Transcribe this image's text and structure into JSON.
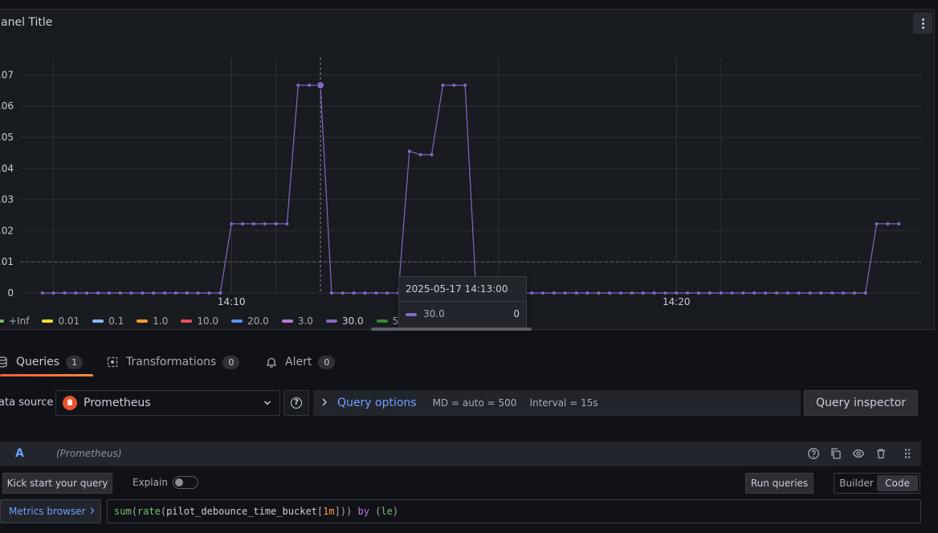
{
  "panel": {
    "title": "anel Title",
    "menu_icon": "kebab-menu-icon"
  },
  "chart_data": {
    "type": "line",
    "y_ticks": [
      "0",
      ".01",
      ".02",
      ".03",
      ".04",
      ".05",
      ".06",
      ".07"
    ],
    "ylim": [
      0,
      0.0755
    ],
    "x_tick_labels": [
      {
        "time": "14:10",
        "label": "14:10"
      },
      {
        "time": "14:20",
        "label": "14:20"
      }
    ],
    "xlim": [
      "14:05:15",
      "14:25:30"
    ],
    "threshold": 0.01,
    "grid": true,
    "series": [
      {
        "name": "30.0",
        "color": "#8268c4",
        "x": [
          "14:05:45",
          "14:06:00",
          "14:06:15",
          "14:06:30",
          "14:06:45",
          "14:07:00",
          "14:07:15",
          "14:07:30",
          "14:07:45",
          "14:08:00",
          "14:08:15",
          "14:08:30",
          "14:08:45",
          "14:09:00",
          "14:09:15",
          "14:09:30",
          "14:09:45",
          "14:10:00",
          "14:10:15",
          "14:10:30",
          "14:10:45",
          "14:11:00",
          "14:11:15",
          "14:11:30",
          "14:11:45",
          "14:12:00",
          "14:12:15",
          "14:12:30",
          "14:12:45",
          "14:13:00",
          "14:13:15",
          "14:13:30",
          "14:13:45",
          "14:14:00",
          "14:14:15",
          "14:14:30",
          "14:14:45",
          "14:15:00",
          "14:15:15",
          "14:15:30",
          "14:15:45",
          "14:16:00",
          "14:16:15",
          "14:16:30",
          "14:16:45",
          "14:17:00",
          "14:17:15",
          "14:17:30",
          "14:17:45",
          "14:18:00",
          "14:18:15",
          "14:18:30",
          "14:18:45",
          "14:19:00",
          "14:19:15",
          "14:19:30",
          "14:19:45",
          "14:20:00",
          "14:20:15",
          "14:20:30",
          "14:20:45",
          "14:21:00",
          "14:21:15",
          "14:21:30",
          "14:21:45",
          "14:22:00",
          "14:22:15",
          "14:22:30",
          "14:22:45",
          "14:23:00",
          "14:23:15",
          "14:23:30",
          "14:23:45",
          "14:24:00",
          "14:24:15",
          "14:24:30",
          "14:24:45",
          "14:25:00"
        ],
        "values": [
          0,
          0,
          0,
          0,
          0,
          0,
          0,
          0,
          0,
          0,
          0,
          0,
          0,
          0,
          0,
          0,
          0,
          0.0222,
          0.0222,
          0.0222,
          0.0222,
          0.0222,
          0.0222,
          0.0667,
          0.0667,
          0.0667,
          0,
          0,
          0,
          0,
          0,
          0,
          0,
          0.0455,
          0.0444,
          0.0444,
          0.0667,
          0.0667,
          0.0667,
          0,
          0,
          0,
          0,
          0,
          0,
          0,
          0,
          0,
          0,
          0,
          0,
          0,
          0,
          0,
          0,
          0,
          0,
          0,
          0,
          0,
          0,
          0,
          0,
          0,
          0,
          0,
          0,
          0,
          0,
          0,
          0,
          0,
          0,
          0,
          0,
          0.0222,
          0.0222,
          0.0222
        ]
      }
    ],
    "hover": {
      "time": "14:12:00",
      "value": 0.0667
    }
  },
  "legend": [
    {
      "label": "+Inf",
      "color": "#73bf69"
    },
    {
      "label": "0.01",
      "color": "#fade2a"
    },
    {
      "label": "0.1",
      "color": "#8ab8ff"
    },
    {
      "label": "1.0",
      "color": "#ff9830"
    },
    {
      "label": "10.0",
      "color": "#f2495c"
    },
    {
      "label": "20.0",
      "color": "#5794f2"
    },
    {
      "label": "3.0",
      "color": "#b877d9"
    },
    {
      "label": "30.0",
      "color": "#8268c4"
    },
    {
      "label": "5.0",
      "color": "#37872d"
    }
  ],
  "tooltip": {
    "time": "2025-05-17 14:13:00",
    "series": "30.0",
    "value": "0",
    "color": "#8268c4"
  },
  "tabs": [
    {
      "label": "Queries",
      "count": "1",
      "icon": "database-icon"
    },
    {
      "label": "Transformations",
      "count": "0",
      "icon": "transform-icon"
    },
    {
      "label": "Alert",
      "count": "0",
      "icon": "bell-icon"
    }
  ],
  "datasource": {
    "label": "ata source",
    "name": "Prometheus",
    "icon": "prometheus-logo-icon"
  },
  "query_options": {
    "label": "Query options",
    "md": "MD = auto = 500",
    "interval": "Interval = 15s"
  },
  "query_inspector": "Query inspector",
  "query": {
    "ref": "A",
    "datasource": "(Prometheus)",
    "kickstart": "Kick start your query",
    "explain": "Explain",
    "run": "Run queries",
    "modes": [
      "Builder",
      "Code"
    ],
    "active_mode": "Code",
    "metrics_browser": "Metrics browser",
    "tokens": [
      {
        "t": "sum",
        "c": "fn"
      },
      {
        "t": "(",
        "c": "punc"
      },
      {
        "t": "rate",
        "c": "fn"
      },
      {
        "t": "(",
        "c": "punc"
      },
      {
        "t": "pilot_debounce_time_bucket",
        "c": "plain"
      },
      {
        "t": "[",
        "c": "punc"
      },
      {
        "t": "1m",
        "c": "num"
      },
      {
        "t": "]",
        "c": "punc"
      },
      {
        "t": "))",
        "c": "punc"
      },
      {
        "t": " ",
        "c": "plain"
      },
      {
        "t": "by",
        "c": "kw"
      },
      {
        "t": " (",
        "c": "punc"
      },
      {
        "t": "le",
        "c": "fn"
      },
      {
        "t": ")",
        "c": "punc"
      }
    ]
  }
}
